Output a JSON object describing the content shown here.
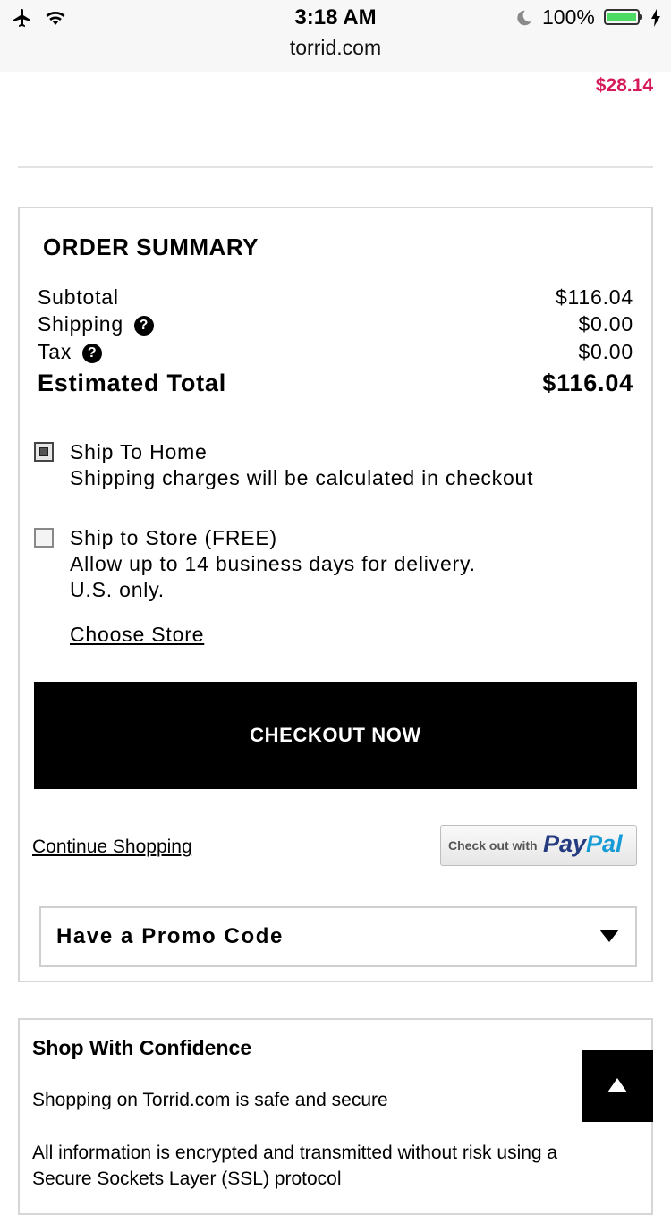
{
  "status_bar": {
    "time": "3:18 AM",
    "url": "torrid.com",
    "battery_percent": "100%",
    "icons": [
      "airplane-icon",
      "wifi-icon",
      "moon-icon",
      "battery-icon",
      "charging-bolt-icon"
    ]
  },
  "cart_item": {
    "price": "$28.14"
  },
  "order_summary": {
    "title": "ORDER SUMMARY",
    "rows": [
      {
        "label": "Subtotal",
        "value": "$116.04"
      },
      {
        "label": "Shipping",
        "value": "$0.00"
      },
      {
        "label": "Tax",
        "value": "$0.00"
      }
    ],
    "help_glyph": "?",
    "total": {
      "label": "Estimated Total",
      "value": "$116.04"
    }
  },
  "shipping_options": [
    {
      "title": "Ship To Home",
      "lines": [
        "Shipping charges will be calculated in checkout"
      ],
      "selected": true
    },
    {
      "title": "Ship to Store (FREE)",
      "lines": [
        "Allow up to 14 business days for delivery.",
        "U.S. only."
      ],
      "selected": false
    }
  ],
  "choose_store_label": "Choose Store",
  "checkout_button": "CHECKOUT NOW",
  "continue_shopping": "Continue Shopping",
  "paypal": {
    "prefix": "Check out with",
    "brand_part1": "Pay",
    "brand_part2": "Pal"
  },
  "promo": {
    "label": "Have a Promo Code"
  },
  "confidence": {
    "title": "Shop With Confidence",
    "p1": "Shopping on Torrid.com is safe and secure",
    "p2": "All information is encrypted and transmitted without risk using a Secure Sockets Layer (SSL) protocol"
  },
  "colors": {
    "price_accent": "#d6195a",
    "button_bg": "#000000",
    "battery_green": "#4cd964",
    "paypal_dark": "#253b80",
    "paypal_light": "#179bd7"
  }
}
